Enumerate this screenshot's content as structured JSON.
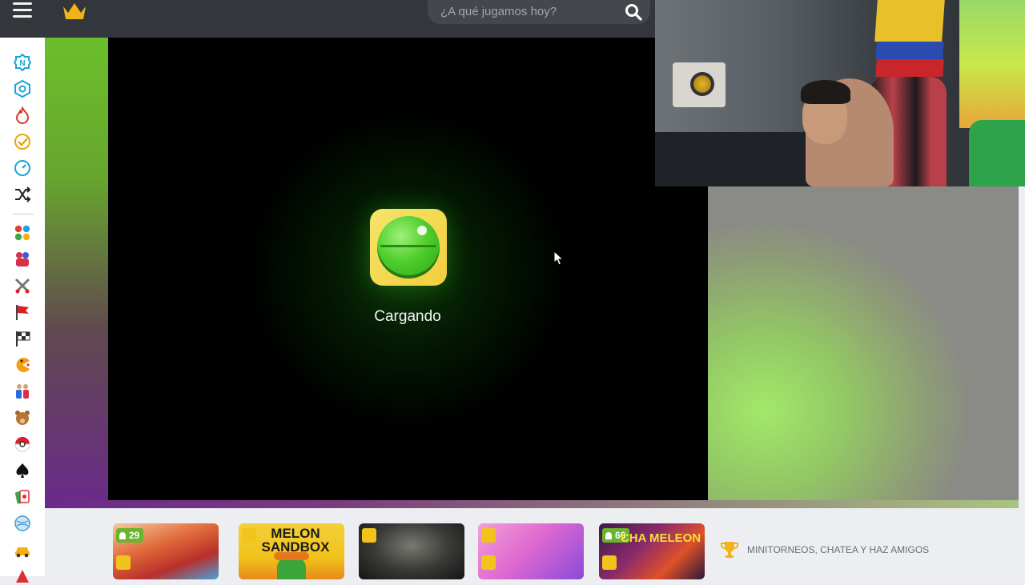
{
  "header": {
    "search_placeholder": "¿A qué jugamos hoy?"
  },
  "sidebar": {
    "items": [
      {
        "icon": "new-icon",
        "color": "#1aa3d9"
      },
      {
        "icon": "hexagon-icon",
        "color": "#1aa3d9"
      },
      {
        "icon": "fire-icon",
        "color": "#e0302a"
      },
      {
        "icon": "check-circle-icon",
        "color": "#e3a810"
      },
      {
        "icon": "timer-icon",
        "color": "#1aa3d9"
      },
      {
        "icon": "shuffle-icon",
        "color": "#222222"
      },
      {
        "icon": "dots-grid-icon",
        "color": "#3aa64a"
      },
      {
        "icon": "fighters-icon",
        "color": "#d9304a"
      },
      {
        "icon": "swords-icon",
        "color": "#555555"
      },
      {
        "icon": "flag-icon",
        "color": "#d9202a"
      },
      {
        "icon": "checkered-flag-icon",
        "color": "#333333"
      },
      {
        "icon": "pacman-icon",
        "color": "#f2a010"
      },
      {
        "icon": "two-players-icon",
        "color": "#2a6ad9"
      },
      {
        "icon": "bear-icon",
        "color": "#a0622a"
      },
      {
        "icon": "pokeball-icon",
        "color": "#d9202a"
      },
      {
        "icon": "spade-icon",
        "color": "#111111"
      },
      {
        "icon": "cards-icon",
        "color": "#d9303a"
      },
      {
        "icon": "ball-icon",
        "color": "#3a9ad9"
      },
      {
        "icon": "car-icon",
        "color": "#f2b010"
      }
    ]
  },
  "game": {
    "loading_text": "Cargando",
    "icon": "watermelon-icon"
  },
  "bottom": {
    "thumbs": [
      {
        "name": "thumb-game-1",
        "players": "29",
        "label": ""
      },
      {
        "name": "thumb-melon-sandbox",
        "players": "",
        "label": "MELON SANDBOX"
      },
      {
        "name": "thumb-game-3",
        "players": "",
        "label": ""
      },
      {
        "name": "thumb-game-4",
        "players": "",
        "label": ""
      },
      {
        "name": "thumb-game-5",
        "players": "66",
        "label": "CHA MELEON"
      }
    ],
    "promo_text": "MINITORNEOS, CHATEA Y HAZ AMIGOS"
  },
  "colors": {
    "topbar": "#33363b",
    "accent_green": "#6ab42e",
    "badge_yellow": "#f2c31a",
    "crown": "#f2b31a"
  }
}
